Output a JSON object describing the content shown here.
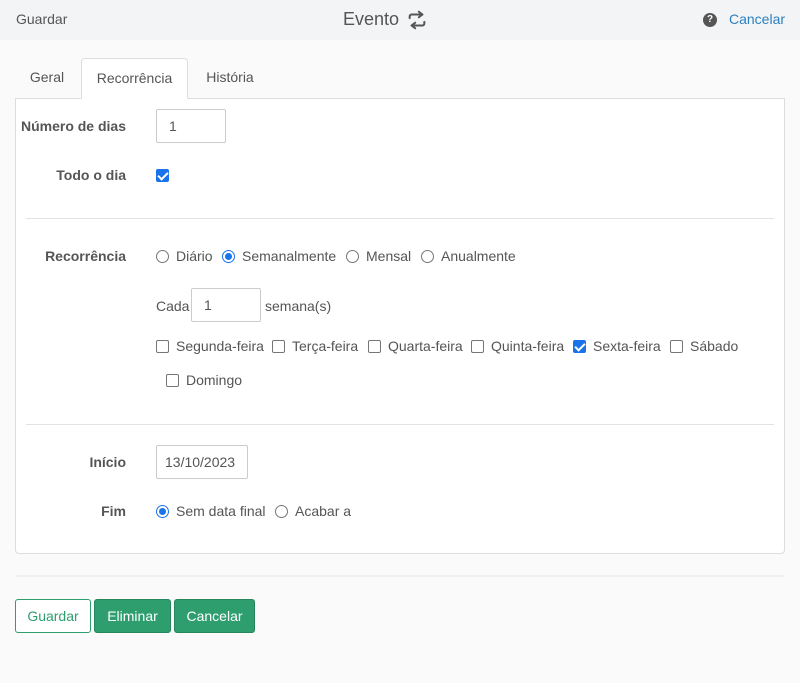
{
  "header": {
    "save_label": "Guardar",
    "title": "Evento",
    "help_icon": "?",
    "cancel_label": "Cancelar"
  },
  "tabs": [
    {
      "label": "Geral",
      "active": false
    },
    {
      "label": "Recorrência",
      "active": true
    },
    {
      "label": "História",
      "active": false
    }
  ],
  "form": {
    "num_days_label": "Número de dias",
    "num_days_value": "1",
    "all_day_label": "Todo o dia",
    "all_day_checked": true,
    "recurrence_label": "Recorrência",
    "recurrence_options": [
      "Diário",
      "Semanalmente",
      "Mensal",
      "Anualmente"
    ],
    "recurrence_selected": "Semanalmente",
    "every_label": "Cada",
    "every_value": "1",
    "every_unit": "semana(s)",
    "weekdays": [
      {
        "label": "Segunda-feira",
        "checked": false
      },
      {
        "label": "Terça-feira",
        "checked": false
      },
      {
        "label": "Quarta-feira",
        "checked": false
      },
      {
        "label": "Quinta-feira",
        "checked": false
      },
      {
        "label": "Sexta-feira",
        "checked": true
      },
      {
        "label": "Sábado",
        "checked": false
      },
      {
        "label": "Domingo",
        "checked": false
      }
    ],
    "start_label": "Início",
    "start_value": "13/10/2023",
    "end_label": "Fim",
    "end_options": [
      "Sem data final",
      "Acabar a"
    ],
    "end_selected": "Sem data final"
  },
  "footer": {
    "save_label": "Guardar",
    "delete_label": "Eliminar",
    "cancel_label": "Cancelar"
  },
  "colors": {
    "accent_blue": "#1a73e8",
    "link_blue": "#2c7fbf",
    "button_green": "#2e9e6e"
  }
}
